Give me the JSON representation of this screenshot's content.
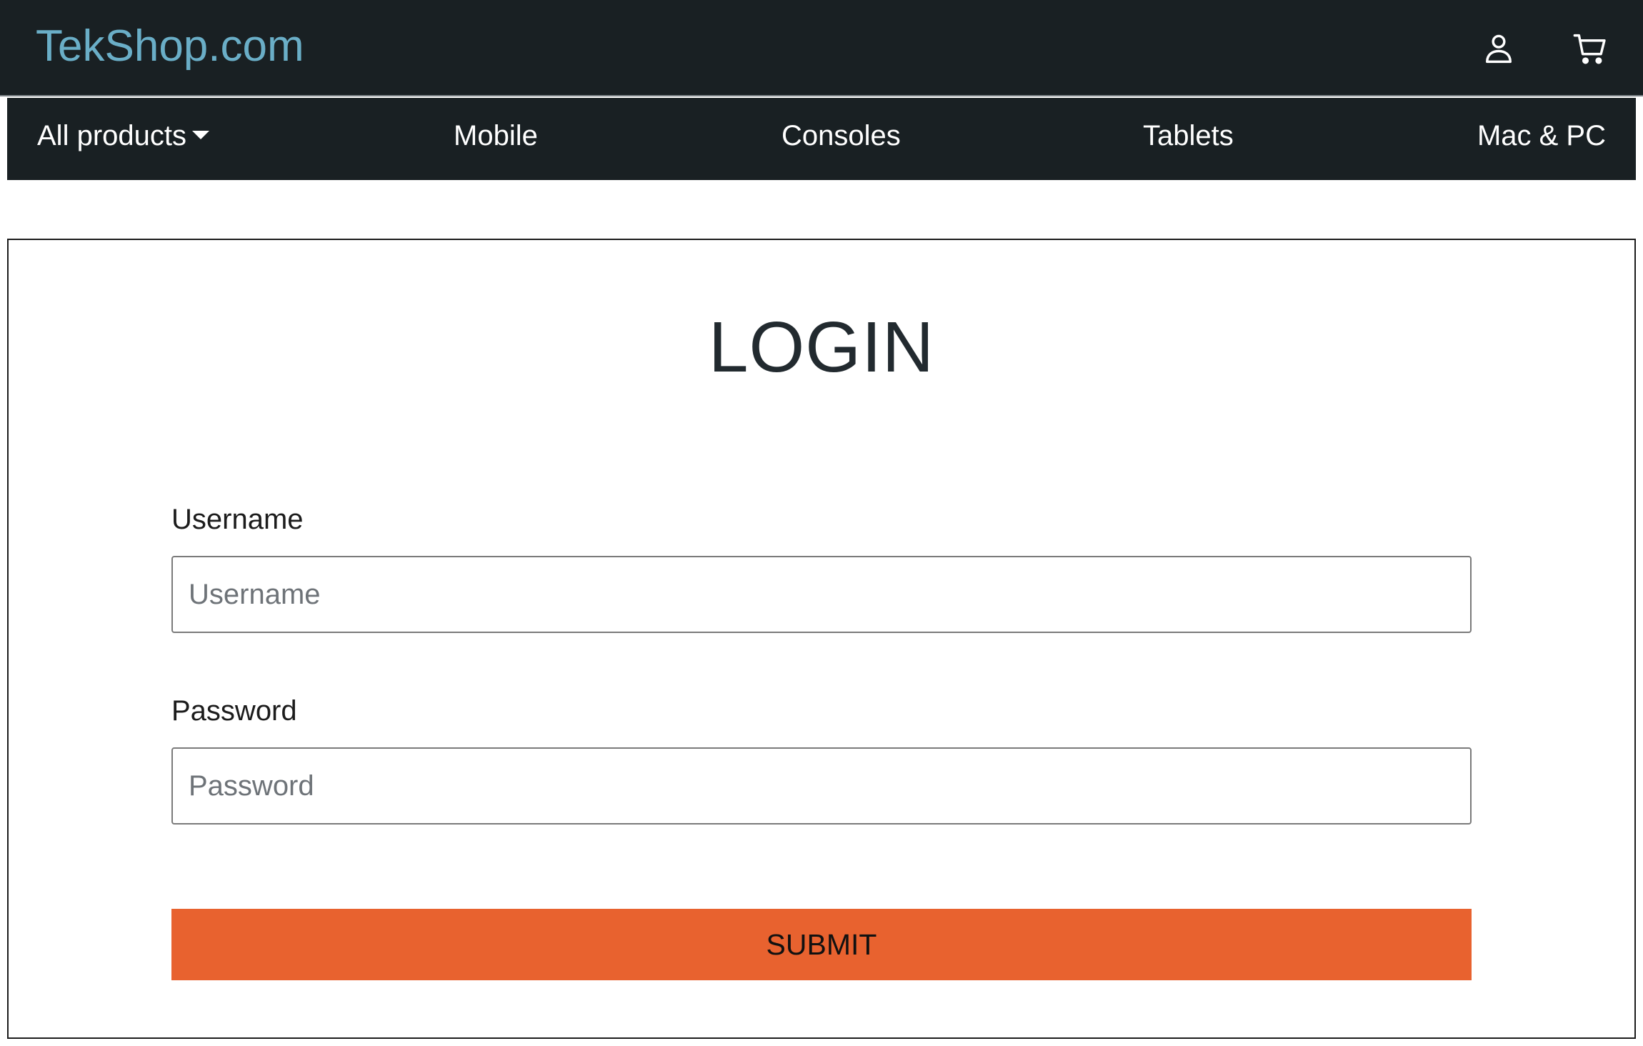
{
  "header": {
    "brand": "TekShop.com",
    "user_icon": "user-icon",
    "cart_icon": "cart-icon"
  },
  "nav": {
    "items": [
      {
        "label": "All products",
        "has_dropdown": true
      },
      {
        "label": "Mobile"
      },
      {
        "label": "Consoles"
      },
      {
        "label": "Tablets"
      },
      {
        "label": "Mac & PC"
      }
    ]
  },
  "login": {
    "title": "LOGIN",
    "username": {
      "label": "Username",
      "placeholder": "Username",
      "value": ""
    },
    "password": {
      "label": "Password",
      "placeholder": "Password",
      "value": ""
    },
    "submit_label": "SUBMIT"
  },
  "colors": {
    "header_bg": "#192023",
    "brand": "#6aaec7",
    "submit_bg": "#e8622f",
    "title_text": "#222a2f"
  }
}
